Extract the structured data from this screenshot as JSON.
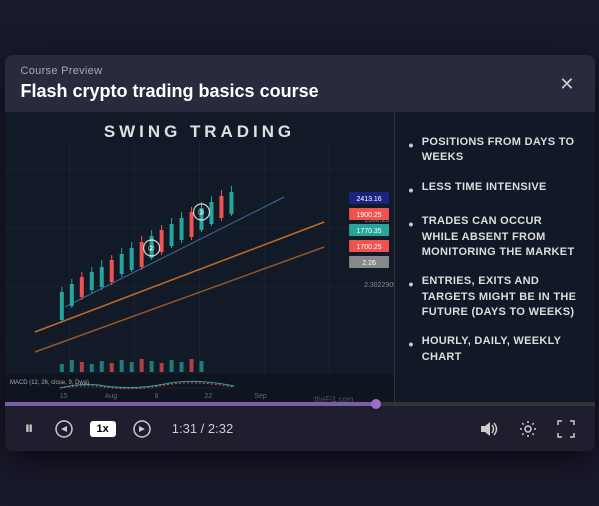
{
  "header": {
    "label": "Course Preview",
    "title": "Flash crypto trading basics course",
    "close_icon": "✕"
  },
  "video": {
    "swing_title": "SWING TRADING",
    "watermark": "theFi1.com"
  },
  "bullets": [
    "POSITIONS FROM DAYS TO WEEKS",
    "LESS TIME INTENSIVE",
    "TRADES CAN OCCUR WHILE ABSENT FROM MONITORING THE MARKET",
    "ENTRIES, EXITS AND TARGETS MIGHT BE IN THE FUTURE (DAYS TO WEEKS)",
    "HOURLY, DAILY, WEEKLY CHART"
  ],
  "progress": {
    "fill_percent": 63,
    "current_time": "1:31",
    "total_time": "2:32",
    "time_display": "1:31 / 2:32"
  },
  "controls": {
    "pause_icon": "⏸",
    "rewind_icon": "↺",
    "speed_label": "1x",
    "forward_icon": "↻",
    "volume_icon": "🔊",
    "settings_icon": "⚙",
    "fullscreen_icon": "⛶"
  }
}
